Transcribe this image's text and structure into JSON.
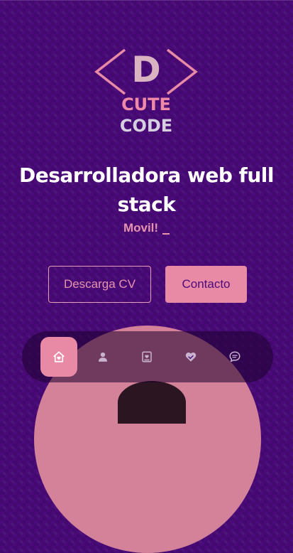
{
  "logo": {
    "letter": "D",
    "name_part1": "CUTE",
    "name_part2": "CODE"
  },
  "hero": {
    "title": "Desarrolladora web full stack",
    "typed_text": "Movil!"
  },
  "buttons": {
    "cv_label": "Descarga CV",
    "contact_label": "Contacto"
  },
  "nav": {
    "items": [
      {
        "icon": "home-icon",
        "active": true
      },
      {
        "icon": "user-icon",
        "active": false
      },
      {
        "icon": "book-icon",
        "active": false
      },
      {
        "icon": "handshake-heart-icon",
        "active": false
      },
      {
        "icon": "chat-icon",
        "active": false
      }
    ]
  },
  "colors": {
    "background": "#4b0a7a",
    "accent_pink": "#e88aa6",
    "text_white": "#ffffff"
  }
}
